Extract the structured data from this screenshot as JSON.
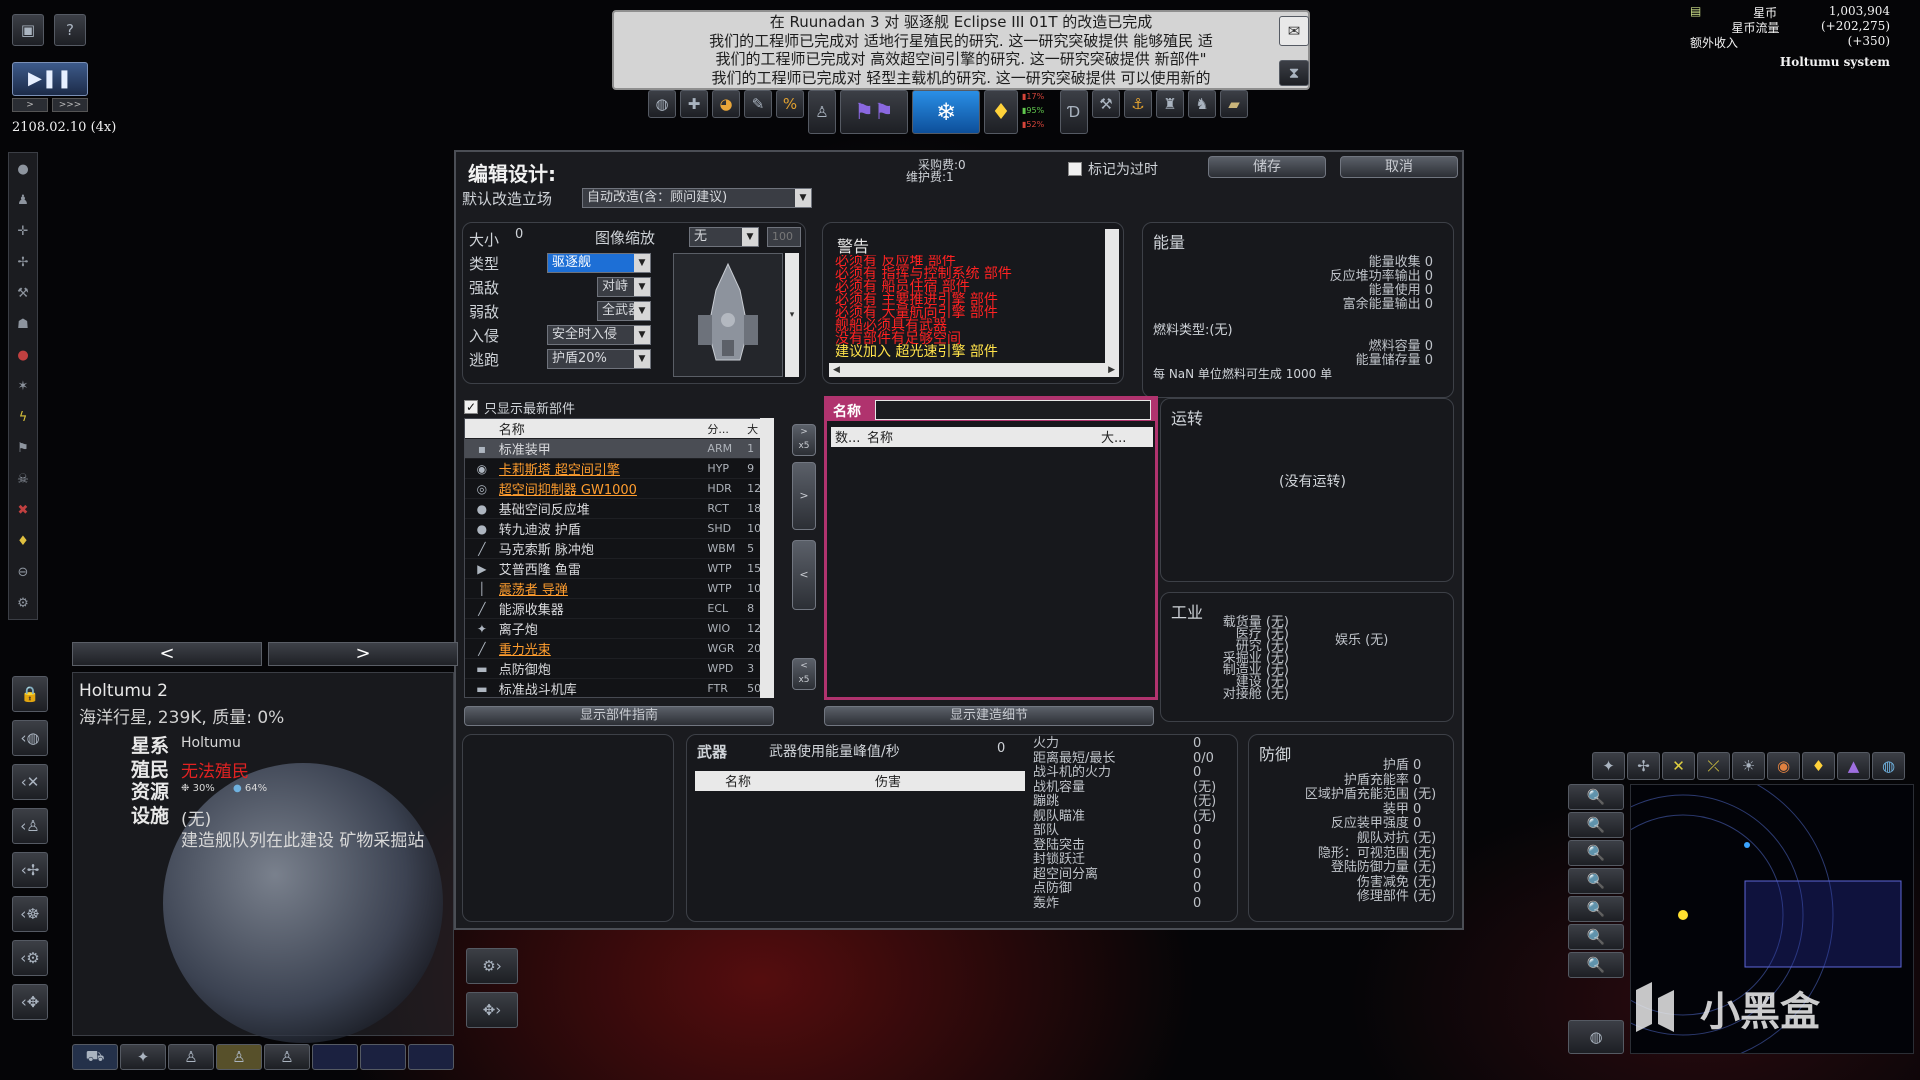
{
  "ticker": {
    "lines": [
      "在 Ruunadan 3 对 驱逐舰 Eclipse III 01T 的改造已完成",
      "我们的工程师已完成对 适地行星殖民的研究. 这一研究突破提供 能够殖民 适",
      "我们的工程师已完成对 高效超空间引擎的研究. 这一研究突破提供 新部件\"",
      "我们的工程师已完成对 轻型主载机的研究. 这一研究突破提供 可以使用新的"
    ]
  },
  "resources": {
    "credits_label": "星币",
    "credits_value": "1,003,904",
    "flow_label": "星币流量",
    "flow_value": "(+202,275)",
    "extra_label": "额外收入",
    "extra_value": "(+350)",
    "system_name": "Holtumu system"
  },
  "game_time": {
    "date": "2108.02.10  (4x)"
  },
  "design": {
    "title": "编辑设计:",
    "purchase_cost": "采购费:0",
    "upkeep_cost": "维护费:1",
    "obsolete_label": "标记为过时",
    "save_label": "储存",
    "cancel_label": "取消",
    "refit_label": "默认改造立场",
    "refit_value": "自动改造(含：顾问建议)",
    "size_label": "大小",
    "size_value": "0",
    "image_scale_label": "图像缩放",
    "image_scale_value": "无",
    "image_scale_num": "100",
    "type_label": "类型",
    "type_value": "驱逐舰",
    "strong_label": "强敌",
    "strong_value": "对峙",
    "weak_label": "弱敌",
    "weak_value": "全武器",
    "invade_label": "入侵",
    "invade_value": "安全时入侵",
    "flee_label": "逃跑",
    "flee_value": "护盾20%",
    "only_latest_label": "只显示最新部件",
    "list_header_name": "名称",
    "list_header_cat": "分...",
    "list_header_size": "大",
    "components": [
      {
        "name": "标准装甲",
        "code": "ARM",
        "size": "1",
        "style": "white",
        "icon": "▪"
      },
      {
        "name": "卡莉斯塔 超空间引擎",
        "code": "HYP",
        "size": "9",
        "style": "orange",
        "icon": "◉"
      },
      {
        "name": "超空间抑制器 GW1000",
        "code": "HDR",
        "size": "12",
        "style": "orange",
        "icon": "◎"
      },
      {
        "name": "基础空间反应堆",
        "code": "RCT",
        "size": "18",
        "style": "white",
        "icon": "●"
      },
      {
        "name": "转九迪波 护盾",
        "code": "SHD",
        "size": "10",
        "style": "white",
        "icon": "●"
      },
      {
        "name": "马克索斯 脉冲炮",
        "code": "WBM",
        "size": "5",
        "style": "white",
        "icon": "╱"
      },
      {
        "name": "艾普西隆 鱼雷",
        "code": "WTP",
        "size": "15",
        "style": "white",
        "icon": "▶"
      },
      {
        "name": "震荡者 导弹",
        "code": "WTP",
        "size": "10",
        "style": "orange",
        "icon": "│"
      },
      {
        "name": "能源收集器",
        "code": "ECL",
        "size": "8",
        "style": "white",
        "icon": "╱"
      },
      {
        "name": "离子炮",
        "code": "WIO",
        "size": "12",
        "style": "white",
        "icon": "✦"
      },
      {
        "name": "重力光束",
        "code": "WGR",
        "size": "20",
        "style": "orange",
        "icon": "╱"
      },
      {
        "name": "点防御炮",
        "code": "WPD",
        "size": "3",
        "style": "white",
        "icon": "▬"
      },
      {
        "name": "标准战斗机库",
        "code": "FTR",
        "size": "50",
        "style": "white",
        "icon": "▬"
      }
    ],
    "show_component_guide": "显示部件指南",
    "show_build_details": "显示建造细节",
    "warnings_title": "警告",
    "warnings": [
      {
        "text": "必须有 反应堆 部件",
        "color": "red"
      },
      {
        "text": "必须有 指挥与控制系统 部件",
        "color": "red"
      },
      {
        "text": "必须有 船员住宿 部件",
        "color": "red"
      },
      {
        "text": "必须有 主要推进引擎 部件",
        "color": "red"
      },
      {
        "text": "必须有 大量航向引擎 部件",
        "color": "red"
      },
      {
        "text": "舰船必须具有武器",
        "color": "red"
      },
      {
        "text": "没有部件有足够空间",
        "color": "red"
      },
      {
        "text": "建议加入 超光速引擎 部件",
        "color": "yellow"
      }
    ],
    "name_label": "名称",
    "name_value": "",
    "installed_header_qty": "数...",
    "installed_header_name": "名称",
    "installed_header_size": "大...",
    "energy": {
      "title": "能量",
      "lines": [
        {
          "label": "能量收集",
          "value": "0"
        },
        {
          "label": "反应堆功率输出",
          "value": "0"
        },
        {
          "label": "能量使用",
          "value": "0"
        },
        {
          "label": "富余能量输出",
          "value": "0"
        }
      ],
      "fuel_type": "燃料类型:(无)",
      "fuel_capacity_label": "燃料容量",
      "fuel_capacity_value": "0",
      "energy_storage_label": "能量储存量",
      "energy_storage_value": "0",
      "per_unit": "每 NaN 单位燃料可生成 1000 单"
    },
    "operations": {
      "title": "运转",
      "empty": "(没有运转)"
    },
    "industry": {
      "title": "工业",
      "lines": [
        {
          "label": "载货量",
          "value": "(无)"
        },
        {
          "label": "医疗",
          "value": "(无)"
        },
        {
          "label": "研究",
          "value": "(无)"
        },
        {
          "label": "采掘业",
          "value": "(无)"
        },
        {
          "label": "制造业",
          "value": "(无)"
        },
        {
          "label": "建设",
          "value": "(无)"
        },
        {
          "label": "对接舱",
          "value": "(无)"
        }
      ],
      "leisure_label": "娱乐",
      "leisure_value": "(无)"
    },
    "weapons": {
      "title": "武器",
      "peak_label": "武器使用能量峰值/秒",
      "peak_value": "0",
      "header_name": "名称",
      "header_damage": "伤害",
      "stats": [
        {
          "label": "火力",
          "value": "0"
        },
        {
          "label": "距离最短/最长",
          "value": "0/0"
        },
        {
          "label": "战斗机的火力",
          "value": "0"
        },
        {
          "label": "战机容量",
          "value": "(无)"
        },
        {
          "label": "蹦跳",
          "value": "(无)"
        },
        {
          "label": "舰队瞄准",
          "value": "(无)"
        },
        {
          "label": "部队",
          "value": "0"
        },
        {
          "label": "登陆突击",
          "value": "0"
        },
        {
          "label": "封锁跃迁",
          "value": "0"
        },
        {
          "label": "超空间分离",
          "value": "0"
        },
        {
          "label": "点防御",
          "value": "0"
        },
        {
          "label": "轰炸",
          "value": "0"
        }
      ]
    },
    "defense": {
      "title": "防御",
      "lines": [
        {
          "label": "护盾",
          "value": "0"
        },
        {
          "label": "护盾充能率",
          "value": "0"
        },
        {
          "label": "区域护盾充能范围",
          "value": "(无)"
        },
        {
          "label": "装甲",
          "value": "0"
        },
        {
          "label": "反应装甲强度",
          "value": "0"
        },
        {
          "label": "舰队对抗",
          "value": "(无)"
        },
        {
          "label": "隐形：可视范围",
          "value": "(无)"
        },
        {
          "label": "登陆防御力量",
          "value": "(无)"
        },
        {
          "label": "伤害减免",
          "value": "(无)"
        },
        {
          "label": "修理部件",
          "value": "(无)"
        }
      ]
    }
  },
  "planet": {
    "name": "Holtumu 2",
    "desc": "海洋行星, 239K, 质量: 0%",
    "star_label": "星系",
    "star_value": "Holtumu",
    "colony_label": "殖民",
    "colony_value": "无法殖民",
    "resources_label": "资源",
    "res1": "30%",
    "res2": "64%",
    "facilities_label": "设施",
    "facilities_value": "(无)",
    "build_note": "建造舰队列在此建设 矿物采掘站"
  },
  "watermark": "小黑盒",
  "colors": {
    "accent_pink": "#b0336e",
    "warn_red": "#ff2222",
    "orange_link": "#ff9d2e"
  }
}
